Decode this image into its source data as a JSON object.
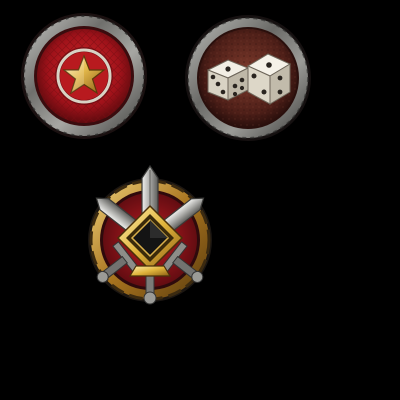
{
  "badges": [
    {
      "id": "star",
      "icon": "star-emblem-icon",
      "accent": "#b5161a"
    },
    {
      "id": "dice",
      "icon": "dice-pair-icon",
      "accent": "#5b2a20"
    },
    {
      "id": "swords",
      "icon": "crossed-swords-diamond-icon",
      "accent": "#a51a1a"
    }
  ],
  "colors": {
    "background": "#000000",
    "metal_rim": "#8a8a88",
    "gold": "#d6a93a",
    "red_field": "#b5161a",
    "leather": "#6b2d22",
    "dice_white": "#e8e4da"
  }
}
